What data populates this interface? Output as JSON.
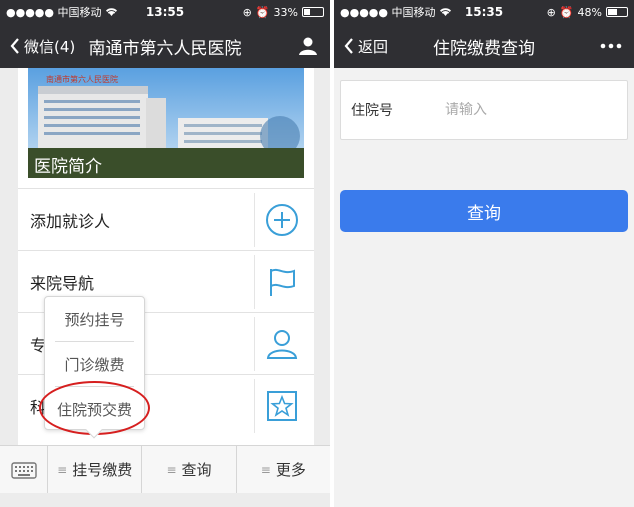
{
  "left": {
    "status": {
      "carrier": "●●●●● 中国移动",
      "time": "13:55",
      "battery": "33%",
      "battery_level": 0.33
    },
    "nav": {
      "back_label": "微信(4)",
      "title": "南通市第六人民医院"
    },
    "intro": {
      "caption": "医院简介",
      "banner_text": "南通市第六人民医院"
    },
    "rows": [
      {
        "label": "添加就诊人",
        "icon": "plus-circle-icon"
      },
      {
        "label": "来院导航",
        "icon": "flag-icon"
      },
      {
        "label": "专",
        "icon": "person-icon"
      },
      {
        "label": "科",
        "icon": "star-icon"
      }
    ],
    "popup": {
      "items": [
        "预约挂号",
        "门诊缴费",
        "住院预交费"
      ]
    },
    "bottom_menu": {
      "items": [
        "挂号缴费",
        "查询",
        "更多"
      ]
    }
  },
  "right": {
    "status": {
      "carrier": "●●●●● 中国移动",
      "time": "15:35",
      "battery": "48%",
      "battery_level": 0.48
    },
    "nav": {
      "back_label": "返回",
      "title": "住院缴费查询"
    },
    "field": {
      "label": "住院号",
      "placeholder": "请输入",
      "value": ""
    },
    "button_label": "查询"
  },
  "colors": {
    "nav_bg": "#2f2f33",
    "accent_blue": "#3a7bec",
    "icon_blue": "#3a9fd8",
    "highlight_red": "#d61f1f"
  }
}
